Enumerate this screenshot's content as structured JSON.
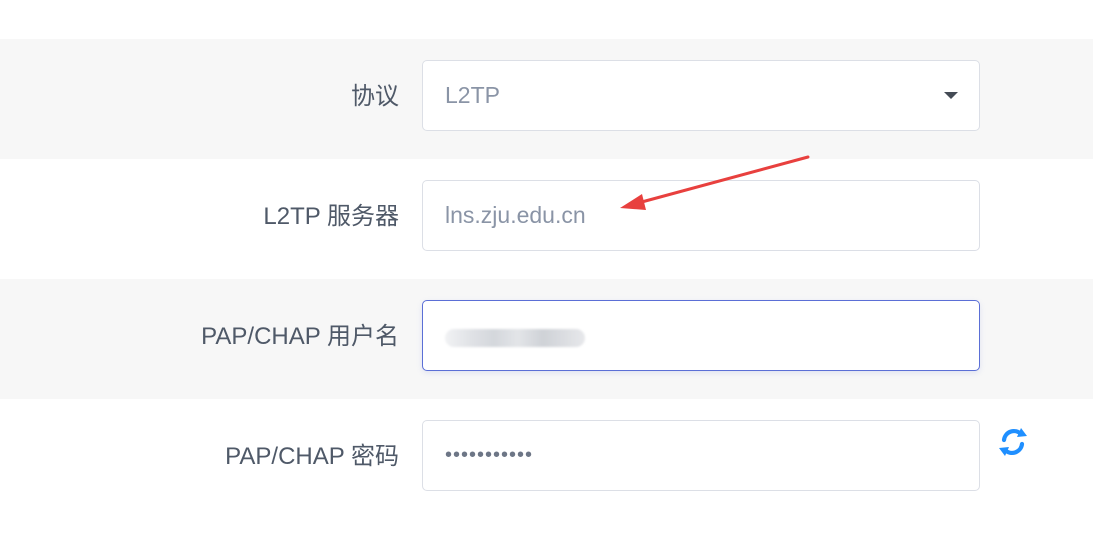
{
  "form": {
    "rows": [
      {
        "label": "协议",
        "type": "select",
        "value": "L2TP",
        "icon": "chevron-down-icon"
      },
      {
        "label": "L2TP 服务器",
        "type": "text",
        "value": "lns.zju.edu.cn"
      },
      {
        "label": "PAP/CHAP 用户名",
        "type": "text",
        "value": ""
      },
      {
        "label": "PAP/CHAP 密码",
        "type": "password",
        "value": "•••••••••••",
        "icon": "refresh-icon"
      }
    ]
  },
  "colors": {
    "accent": "#1f8fff",
    "arrow": "#e8403e",
    "focused_border": "#5b6fd6",
    "shaded_row": "#f7f7f7"
  }
}
